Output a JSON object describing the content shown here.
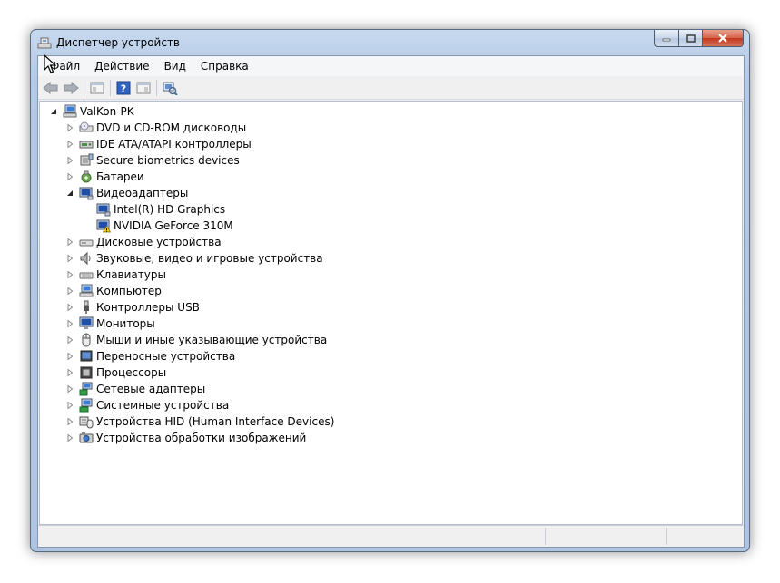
{
  "window": {
    "title": "Диспетчер устройств",
    "icon": "device-manager-icon"
  },
  "menu": [
    "Файл",
    "Действие",
    "Вид",
    "Справка"
  ],
  "toolbar": [
    "back-arrow-icon",
    "forward-arrow-icon",
    "properties-pane-icon",
    "help-icon",
    "details-view-icon",
    "scan-hardware-icon"
  ],
  "tree": {
    "root": {
      "label": "ValKon-PK",
      "icon": "computer-icon",
      "expanded": true
    },
    "items": [
      {
        "label": "DVD и CD-ROM дисководы",
        "icon": "dvd-drive-icon",
        "expanded": false,
        "children": []
      },
      {
        "label": "IDE ATA/ATAPI контроллеры",
        "icon": "ide-controller-icon",
        "expanded": false,
        "children": []
      },
      {
        "label": "Secure biometrics devices",
        "icon": "biometric-device-icon",
        "expanded": false,
        "children": []
      },
      {
        "label": "Батареи",
        "icon": "battery-icon",
        "expanded": false,
        "children": []
      },
      {
        "label": "Видеоадаптеры",
        "icon": "display-adapter-icon",
        "expanded": true,
        "children": [
          {
            "label": "Intel(R) HD Graphics",
            "icon": "display-adapter-icon",
            "warning": false
          },
          {
            "label": "NVIDIA GeForce 310M",
            "icon": "display-adapter-warning-icon",
            "warning": true
          }
        ]
      },
      {
        "label": "Дисковые устройства",
        "icon": "disk-drive-icon",
        "expanded": false,
        "children": []
      },
      {
        "label": "Звуковые, видео и игровые устройства",
        "icon": "speaker-icon",
        "expanded": false,
        "children": []
      },
      {
        "label": "Клавиатуры",
        "icon": "keyboard-icon",
        "expanded": false,
        "children": []
      },
      {
        "label": "Компьютер",
        "icon": "computer-icon",
        "expanded": false,
        "children": []
      },
      {
        "label": "Контроллеры USB",
        "icon": "usb-icon",
        "expanded": false,
        "children": []
      },
      {
        "label": "Мониторы",
        "icon": "monitor-icon",
        "expanded": false,
        "children": []
      },
      {
        "label": "Мыши и иные указывающие устройства",
        "icon": "mouse-icon",
        "expanded": false,
        "children": []
      },
      {
        "label": "Переносные устройства",
        "icon": "portable-device-icon",
        "expanded": false,
        "children": []
      },
      {
        "label": "Процессоры",
        "icon": "processor-icon",
        "expanded": false,
        "children": []
      },
      {
        "label": "Сетевые адаптеры",
        "icon": "network-adapter-icon",
        "expanded": false,
        "children": []
      },
      {
        "label": "Системные устройства",
        "icon": "system-device-icon",
        "expanded": false,
        "children": []
      },
      {
        "label": "Устройства HID (Human Interface Devices)",
        "icon": "hid-device-icon",
        "expanded": false,
        "children": []
      },
      {
        "label": "Устройства обработки изображений",
        "icon": "imaging-device-icon",
        "expanded": false,
        "children": []
      }
    ]
  },
  "colors": {
    "selection": "#3399ff",
    "warning": "#f2c21b"
  }
}
